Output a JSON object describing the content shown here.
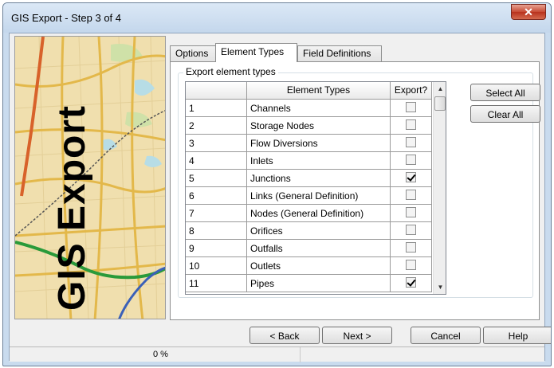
{
  "window": {
    "title": "GIS Export - Step 3 of 4",
    "close_glyph": "✕"
  },
  "side_image": {
    "label": "GIS Export"
  },
  "tabs": [
    {
      "label": "Options",
      "active": false
    },
    {
      "label": "Element Types",
      "active": true
    },
    {
      "label": "Field Definitions",
      "active": false
    }
  ],
  "group": {
    "legend": "Export element types"
  },
  "grid": {
    "columns": [
      "",
      "Element Types",
      "Export?"
    ],
    "rows": [
      {
        "index": "1",
        "name": "Channels",
        "export": false
      },
      {
        "index": "2",
        "name": "Storage Nodes",
        "export": false
      },
      {
        "index": "3",
        "name": "Flow Diversions",
        "export": false
      },
      {
        "index": "4",
        "name": "Inlets",
        "export": false
      },
      {
        "index": "5",
        "name": "Junctions",
        "export": true
      },
      {
        "index": "6",
        "name": "Links (General Definition)",
        "export": false
      },
      {
        "index": "7",
        "name": "Nodes (General Definition)",
        "export": false
      },
      {
        "index": "8",
        "name": "Orifices",
        "export": false
      },
      {
        "index": "9",
        "name": "Outfalls",
        "export": false
      },
      {
        "index": "10",
        "name": "Outlets",
        "export": false
      },
      {
        "index": "11",
        "name": "Pipes",
        "export": true
      }
    ],
    "scroll_up_glyph": "▲",
    "scroll_down_glyph": "▼"
  },
  "actions": {
    "select_all": "Select All",
    "clear_all": "Clear All"
  },
  "navigation": {
    "back": "< Back",
    "next": "Next >",
    "cancel": "Cancel",
    "help": "Help"
  },
  "status": {
    "progress": "0 %"
  },
  "colors": {
    "title_bar": "#c9dbee",
    "close_button": "#c74a33",
    "map_background": "#f0dfae",
    "map_river": "#2a9a3a"
  }
}
